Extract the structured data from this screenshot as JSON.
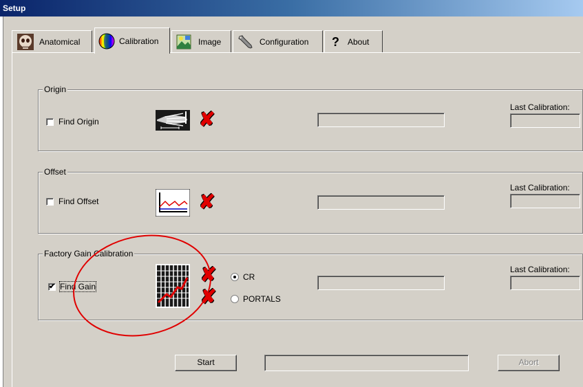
{
  "window": {
    "title": "Setup"
  },
  "tabs": [
    {
      "label": "Anatomical",
      "icon": "skull-icon",
      "active": false
    },
    {
      "label": "Calibration",
      "icon": "color-wheel-icon",
      "active": true
    },
    {
      "label": "Image",
      "icon": "image-icon",
      "active": false
    },
    {
      "label": "Configuration",
      "icon": "wrench-icon",
      "active": false
    },
    {
      "label": "About",
      "icon": "question-mark-icon",
      "active": false
    }
  ],
  "groups": {
    "origin": {
      "legend": "Origin",
      "checkbox_label": "Find Origin",
      "checked": false,
      "last_calibration_label": "Last Calibration:",
      "last_calibration_value": ""
    },
    "offset": {
      "legend": "Offset",
      "checkbox_label": "Find Offset",
      "checked": false,
      "last_calibration_label": "Last Calibration:",
      "last_calibration_value": ""
    },
    "gain": {
      "legend": "Factory Gain Calibration",
      "checkbox_label": "Find Gain",
      "checked": true,
      "last_calibration_label": "Last Calibration:",
      "last_calibration_value": "",
      "radio_options": [
        "CR",
        "PORTALS"
      ],
      "selected_option": "CR"
    }
  },
  "footer": {
    "start_label": "Start",
    "abort_label": "Abort",
    "abort_enabled": false
  },
  "colors": {
    "annotation_circle": "#e00000",
    "status_x": "#e00000",
    "face": "#d4d0c8"
  }
}
